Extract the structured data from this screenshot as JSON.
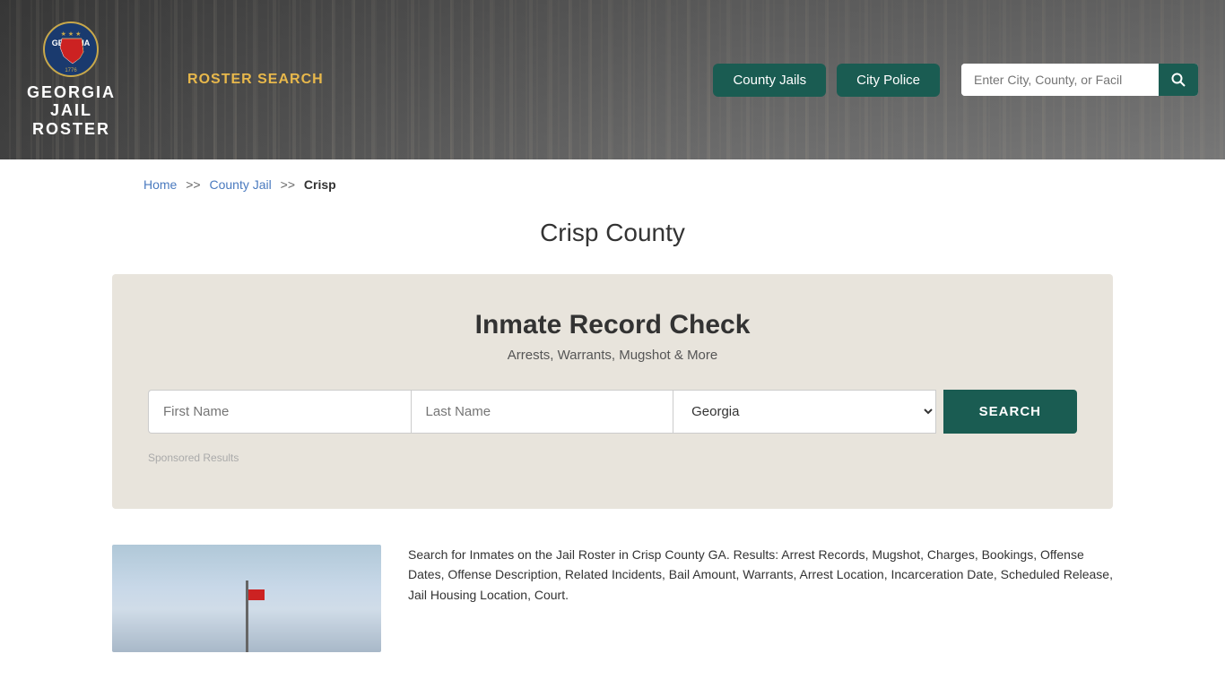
{
  "header": {
    "logo": {
      "line1": "GEORGIA",
      "line2": "JAIL",
      "line3": "ROSTER"
    },
    "nav_link": "ROSTER SEARCH",
    "btn_county_jails": "County Jails",
    "btn_city_police": "City Police",
    "search_placeholder": "Enter City, County, or Facil"
  },
  "breadcrumb": {
    "home": "Home",
    "sep1": ">>",
    "county_jail": "County Jail",
    "sep2": ">>",
    "current": "Crisp"
  },
  "page_title": "Crisp County",
  "record_check": {
    "title": "Inmate Record Check",
    "subtitle": "Arrests, Warrants, Mugshot & More",
    "first_name_placeholder": "First Name",
    "last_name_placeholder": "Last Name",
    "state_default": "Georgia",
    "search_btn": "SEARCH",
    "sponsored_label": "Sponsored Results"
  },
  "bottom": {
    "description": "Search for Inmates on the Jail Roster in Crisp County GA. Results: Arrest Records, Mugshot, Charges, Bookings, Offense Dates, Offense Description, Related Incidents, Bail Amount, Warrants, Arrest Location, Incarceration Date, Scheduled Release, Jail Housing Location, Court."
  }
}
